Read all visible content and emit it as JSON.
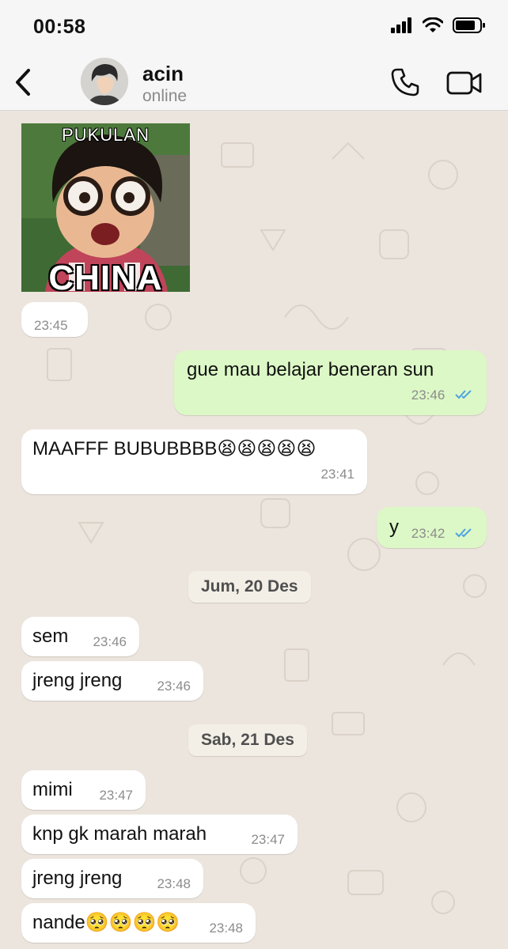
{
  "status_bar": {
    "time": "00:58"
  },
  "header": {
    "contact_name": "acin",
    "contact_status": "online"
  },
  "sticker": {
    "caption_top": "PUKULAN",
    "caption_bottom": "CHINA",
    "time": "23:45"
  },
  "messages": [
    {
      "direction": "out",
      "text": "gue mau belajar beneran sun",
      "time": "23:46",
      "read": true
    },
    {
      "direction": "in",
      "text": "MAAFFF BUBUBBBB😫😫😫😫😫",
      "time": "23:41"
    },
    {
      "direction": "out",
      "text": "y",
      "time": "23:42",
      "read": true
    }
  ],
  "date_1": "Jum, 20 Des",
  "messages_day2": [
    {
      "direction": "in",
      "text": "sem",
      "time": "23:46"
    },
    {
      "direction": "in",
      "text": "jreng jreng",
      "time": "23:46"
    }
  ],
  "date_2": "Sab, 21 Des",
  "messages_day3": [
    {
      "direction": "in",
      "text": "mimi",
      "time": "23:47"
    },
    {
      "direction": "in",
      "text": "knp gk marah marah",
      "time": "23:47"
    },
    {
      "direction": "in",
      "text": "jreng jreng",
      "time": "23:48"
    },
    {
      "direction": "in",
      "text": "nande🥺🥺🥺🥺",
      "time": "23:48"
    }
  ],
  "colors": {
    "incoming": "#ffffff",
    "outgoing": "#dcf8c6",
    "read_ticks": "#4fa3e0",
    "background": "#ece5dd"
  },
  "icons": [
    "back-chevron-icon",
    "phone-icon",
    "video-camera-icon",
    "signal-icon",
    "wifi-icon",
    "battery-icon",
    "double-check-icon"
  ]
}
